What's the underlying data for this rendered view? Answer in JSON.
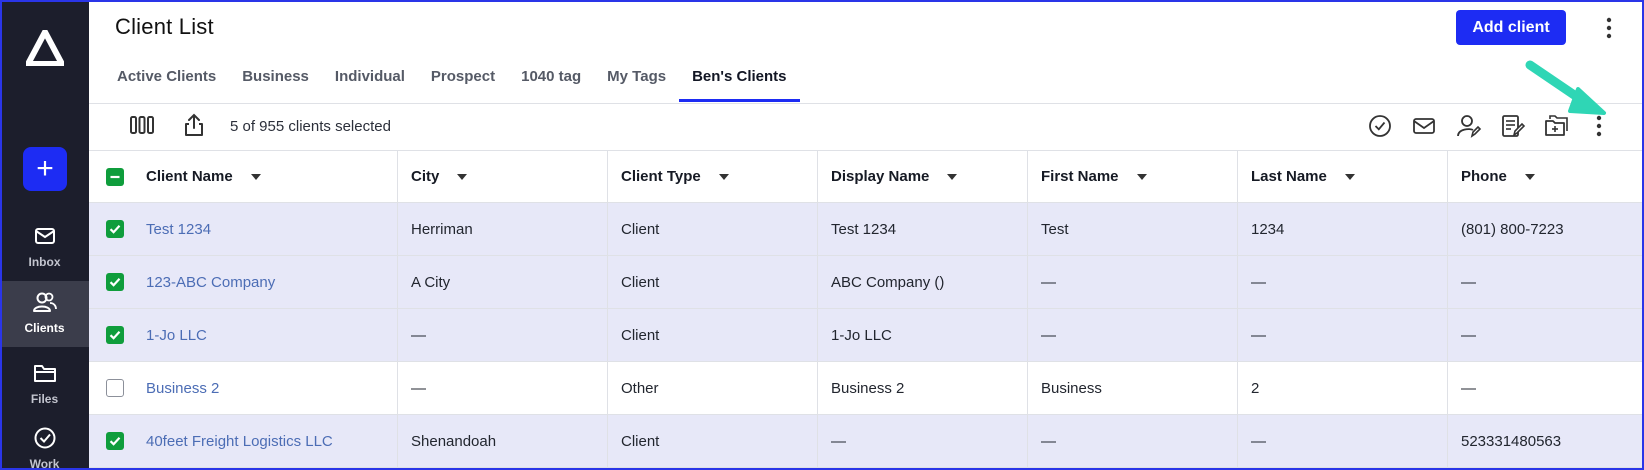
{
  "sidebar": {
    "nav": [
      {
        "label": "Inbox",
        "icon": "mail-icon"
      },
      {
        "label": "Clients",
        "icon": "users-icon"
      },
      {
        "label": "Files",
        "icon": "folder-icon"
      },
      {
        "label": "Work",
        "icon": "check-circle-icon"
      }
    ],
    "active": "Clients"
  },
  "header": {
    "title": "Client List",
    "add_label": "Add client"
  },
  "tabs": [
    "Active Clients",
    "Business",
    "Individual",
    "Prospect",
    "1040 tag",
    "My Tags",
    "Ben's Clients"
  ],
  "active_tab": "Ben's Clients",
  "toolbar": {
    "selection_text": "5 of 955 clients selected"
  },
  "table": {
    "columns": [
      "Client Name",
      "City",
      "Client Type",
      "Display Name",
      "First Name",
      "Last Name",
      "Phone"
    ],
    "rows": [
      {
        "selected": true,
        "cells": [
          "Test 1234",
          "Herriman",
          "Client",
          "Test 1234",
          "Test",
          "1234",
          "(801) 800-7223"
        ]
      },
      {
        "selected": true,
        "cells": [
          "123-ABC Company",
          "A City",
          "Client",
          "ABC Company ()",
          "—",
          "—",
          "—"
        ]
      },
      {
        "selected": true,
        "cells": [
          "1-Jo LLC",
          "—",
          "Client",
          "1-Jo LLC",
          "—",
          "—",
          "—"
        ]
      },
      {
        "selected": false,
        "cells": [
          "Business 2",
          "—",
          "Other",
          "Business 2",
          "Business",
          "2",
          "—"
        ]
      },
      {
        "selected": true,
        "cells": [
          "40feet Freight Logistics LLC",
          "Shenandoah",
          "Client",
          "—",
          "—",
          "—",
          "523331480563"
        ]
      }
    ]
  },
  "colors": {
    "accent": "#1d2cf3",
    "sidebar_bg": "#1c1e2c",
    "checkbox_green": "#0f9d3c",
    "selected_row": "#e7e8f8",
    "link": "#4c6db5",
    "annotation_arrow": "#2fd6b5"
  }
}
